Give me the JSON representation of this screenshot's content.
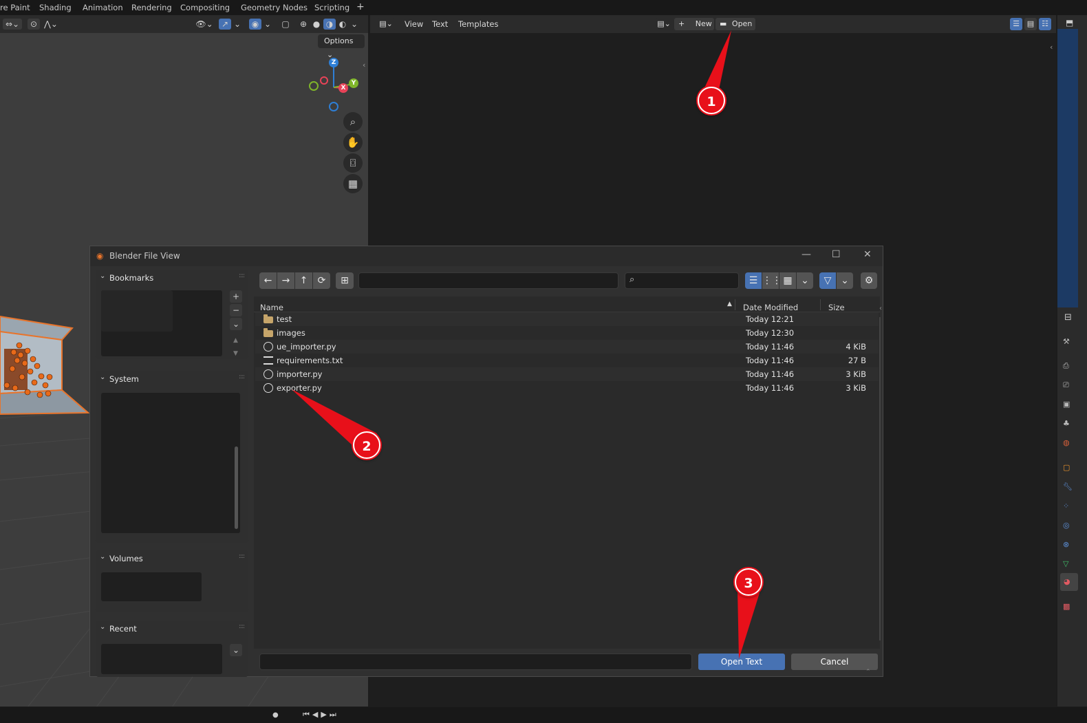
{
  "workspace_tabs": [
    "re Paint",
    "Shading",
    "Animation",
    "Rendering",
    "Compositing",
    "Geometry Nodes",
    "Scripting"
  ],
  "workspace_add": "+",
  "viewport": {
    "options_label": "Options",
    "gizmo": {
      "z": "Z",
      "x": "X",
      "y": "Y"
    }
  },
  "text_editor": {
    "menus": [
      "View",
      "Text",
      "Templates"
    ],
    "new_label": "New",
    "open_label": "Open"
  },
  "dialog": {
    "title": "Blender File View",
    "sidebar": {
      "bookmarks": "Bookmarks",
      "system": "System",
      "volumes": "Volumes",
      "recent": "Recent"
    },
    "columns": {
      "name": "Name",
      "date": "Date Modified",
      "size": "Size"
    },
    "files": [
      {
        "name": "test",
        "date": "Today 12:21",
        "size": "",
        "kind": "folder"
      },
      {
        "name": "images",
        "date": "Today 12:30",
        "size": "",
        "kind": "folder"
      },
      {
        "name": "ue_importer.py",
        "date": "Today 11:46",
        "size": "4 KiB",
        "kind": "python"
      },
      {
        "name": "requirements.txt",
        "date": "Today 11:46",
        "size": "27 B",
        "kind": "text"
      },
      {
        "name": "importer.py",
        "date": "Today 11:46",
        "size": "3 KiB",
        "kind": "python"
      },
      {
        "name": "exporter.py",
        "date": "Today 11:46",
        "size": "3 KiB",
        "kind": "python"
      }
    ],
    "open_button": "Open Text",
    "cancel_button": "Cancel"
  },
  "annotations": [
    "1",
    "2",
    "3"
  ],
  "colors": {
    "accent": "#4772b3",
    "marker": "#e8101a",
    "folder": "#c6a56a"
  }
}
